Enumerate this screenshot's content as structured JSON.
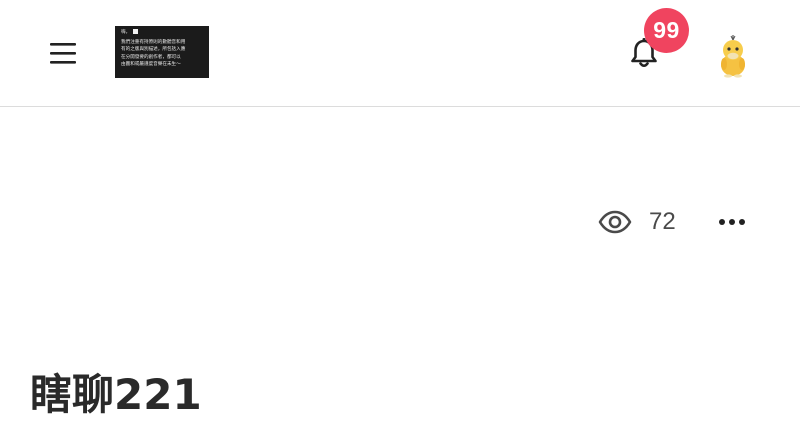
{
  "header": {
    "menu_icon": "hamburger-menu-icon",
    "logo": {
      "top_text": "嗨，",
      "lines": [
        "我們注重有持原則的數聽音和用",
        "有的之版與別描述，所包括入應",
        "在分開發要的創作者，都可以",
        "由圖和或嚴謹度音樂在未生～"
      ]
    },
    "notifications": {
      "icon": "bell-icon",
      "badge_count": "99",
      "badge_color": "#f0445f"
    },
    "avatar_icon": "duck-avatar-icon"
  },
  "post": {
    "views_icon": "eye-icon",
    "view_count": "72",
    "more_icon": "more-horizontal-icon",
    "title": "瞎聊221"
  }
}
